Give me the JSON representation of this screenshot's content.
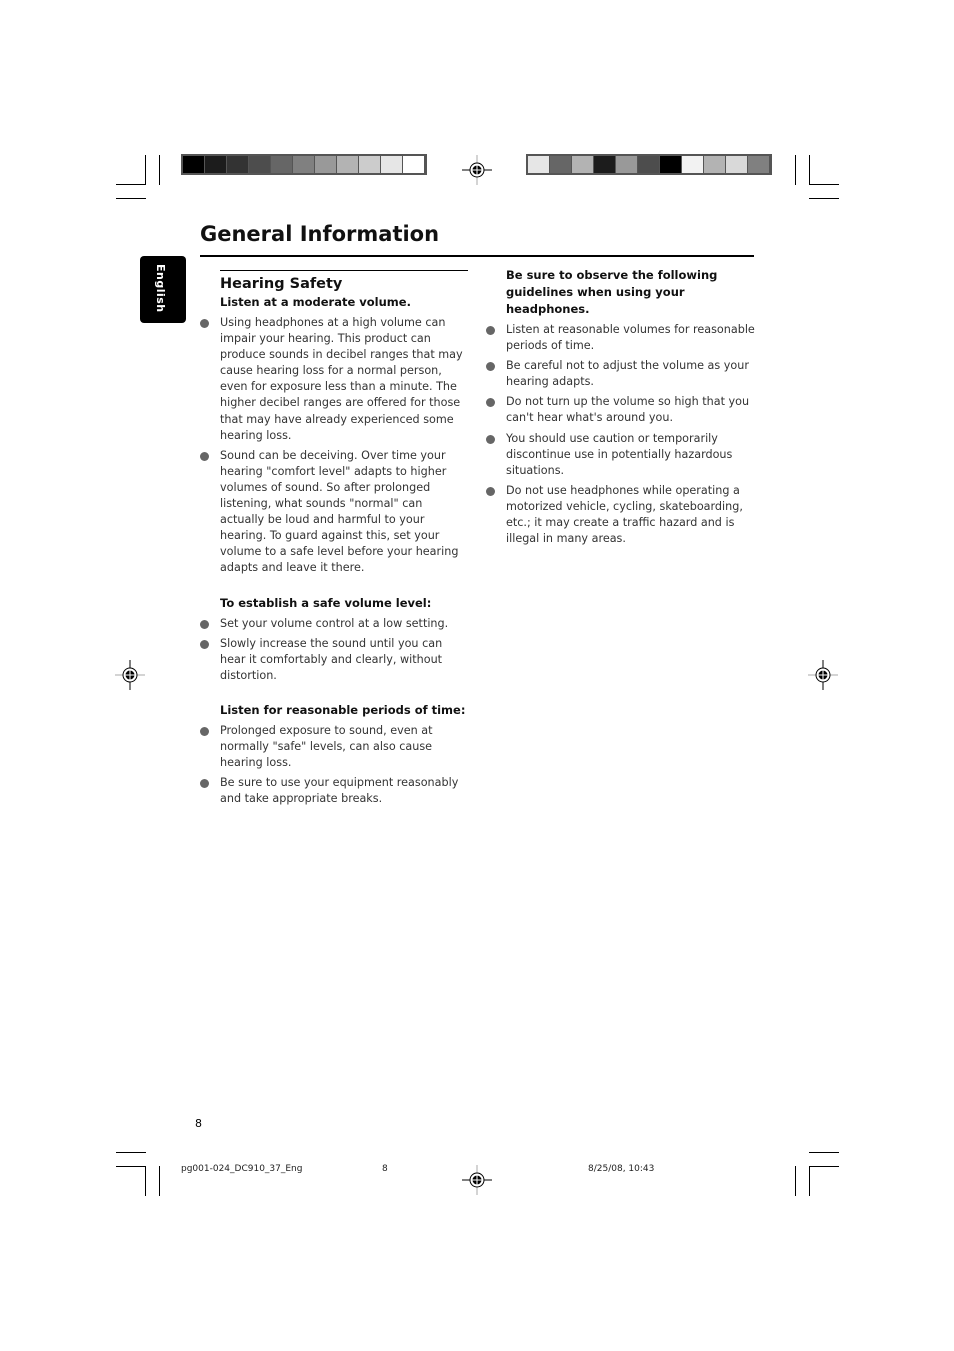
{
  "page": {
    "title": "General Information",
    "language_tab": "English",
    "page_number": "8"
  },
  "left_column": {
    "section_title": "Hearing Safety",
    "subsections": [
      {
        "heading": "Listen at a moderate volume.",
        "bullets": [
          "Using headphones at a high volume can impair your hearing. This product can produce sounds in decibel ranges that may cause hearing loss for a normal person, even for exposure less than a minute. The higher decibel ranges are offered for those that may have already experienced some hearing loss.",
          "Sound can be deceiving. Over time your hearing \"comfort level\" adapts to higher volumes of sound. So after prolonged listening, what sounds \"normal\" can actually be loud and harmful to your hearing. To guard against this, set your volume to a safe level before your hearing adapts and leave it there."
        ]
      },
      {
        "heading": "To establish a safe volume level:",
        "bullets": [
          "Set your volume control at a low setting.",
          "Slowly increase the sound until you can hear it comfortably and clearly, without distortion."
        ]
      },
      {
        "heading": "Listen for reasonable periods of time:",
        "bullets": [
          "Prolonged exposure to sound, even at normally \"safe\" levels, can also cause hearing loss.",
          "Be sure to use your equipment reasonably and take appropriate breaks."
        ]
      }
    ]
  },
  "right_column": {
    "heading": "Be sure to observe the following guidelines when using your headphones.",
    "bullets": [
      "Listen at reasonable volumes for reasonable periods of time.",
      "Be careful not to adjust the volume as your hearing adapts.",
      "Do not turn up the volume so high that you can't hear what's around you.",
      "You should use caution or temporarily discontinue use in potentially hazardous situations.",
      "Do not use headphones while operating a motorized vehicle, cycling, skateboarding, etc.; it may create a traffic hazard and is illegal in many areas."
    ]
  },
  "print_marks": {
    "footer_file": "pg001-024_DC910_37_Eng",
    "footer_page": "8",
    "footer_date": "8/25/08, 10:43",
    "left_strip_colors": [
      "#000000",
      "#1c1c1c",
      "#333333",
      "#4d4d4d",
      "#666666",
      "#808080",
      "#999999",
      "#b3b3b3",
      "#cccccc",
      "#e6e6e6",
      "#ffffff"
    ],
    "right_strip_colors": [
      "#e6e6e6",
      "#666666",
      "#b3b3b3",
      "#1c1c1c",
      "#999999",
      "#4d4d4d",
      "#000000",
      "#f2f2f2",
      "#b3b3b3",
      "#d9d9d9",
      "#808080"
    ]
  }
}
